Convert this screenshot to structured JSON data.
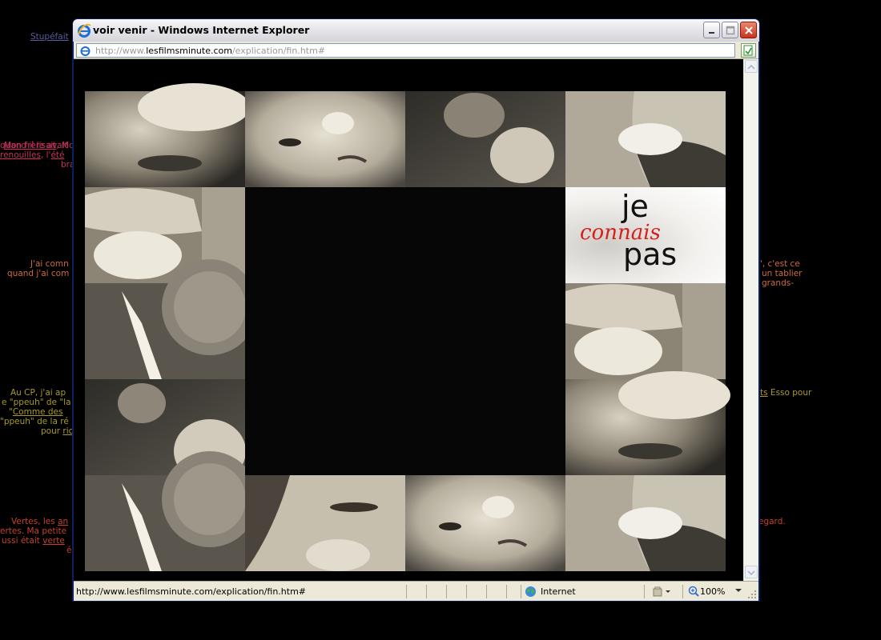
{
  "window": {
    "title": "voir venir - Windows Internet Explorer",
    "address": {
      "prefix": "http://www.",
      "domain": "lesfilmsminute.com",
      "path": "/explication/fin.htm#"
    },
    "status_url": "http://www.lesfilmsminute.com/explication/fin.htm#",
    "zone": "Internet",
    "zoom": "100%"
  },
  "overlay": {
    "word1": "je",
    "word2": "connais",
    "word3": "pas"
  },
  "background_text": {
    "link_top": "Stupéfait",
    "p1_l1_link": "Mon frère",
    "p1_l1_rest": " avait",
    "p1_l2_pre": "quand il ",
    "p1_l2_link": "lisait",
    "p1_l2_post": ", Mo",
    "p1_l3_link": "renouilles",
    "p1_l3_mid": ", l'",
    "p1_l3_link2": "été",
    "p1_l4": "bra",
    "p2_l1": "J'ai comn",
    "p2_l2": "quand j'ai com",
    "p2r_l1": "\", c'est ce",
    "p2r_l2": "un tablier",
    "p2r_l3": "grands-",
    "p3_l1": "Au CP, j'ai ap",
    "p3_l2": "e \"ppeuh\" de \"la",
    "p3_l3_pre": "\"",
    "p3_l3_link": "Comme des",
    "p3_l4": "\"ppeuh\" de la ré",
    "p3_l5_pre": "pour ",
    "p3_l5_link": "ric",
    "p3r_link": "ts",
    "p3r_rest": " Esso pour",
    "p4_l1_pre": "Vertes, les ",
    "p4_l1_link": "an",
    "p4_l2": "ertes. Ma petite",
    "p4_l3_pre": "ussi était ",
    "p4_l3_link": "verte",
    "p4_l4": "é",
    "p4r": "egard."
  },
  "colors": {
    "bg": "#000000",
    "link_purple": "#5a5aa0",
    "p1": "#c8305a",
    "p2": "#d06a3a",
    "p3": "#a89a28",
    "p4": "#c84028",
    "overlay_red": "#d8201a"
  }
}
